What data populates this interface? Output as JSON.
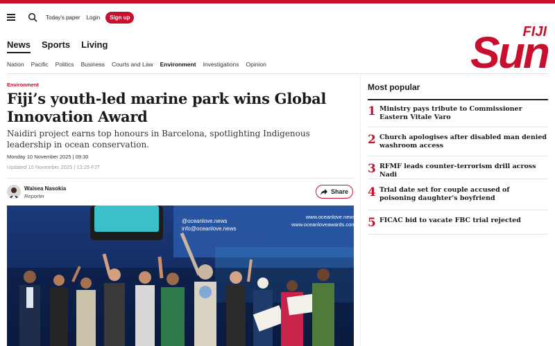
{
  "header": {
    "todays_paper": "Today's paper",
    "login": "Login",
    "signup": "Sign up",
    "logo_top": "FIJI",
    "logo_main": "Sun",
    "brand_color": "#c8102e"
  },
  "primary_nav": [
    "News",
    "Sports",
    "Living"
  ],
  "sub_nav": [
    "Nation",
    "Pacific",
    "Politics",
    "Business",
    "Courts and Law",
    "Environment",
    "Investigations",
    "Opinion"
  ],
  "article": {
    "kicker": "Environment",
    "headline": "Fiji’s youth-led marine park wins Global Innovation Award",
    "standfirst": "Naidiri project earns top honours in Barcelona, spotlighting Indigenous leadership in ocean conservation.",
    "date": "Monday 10 November 2025 | 09:30",
    "updated": "Updated 10 November 2025 | 13:25 FJT",
    "author_name": "Waisea Nasokia",
    "author_role": "Reporter",
    "share_label": "Share",
    "photo_text": {
      "handle_line1": "@oceanlove.news",
      "handle_line2": "info@oceanlove.news",
      "web_line1": "www.oceanlove.news",
      "web_line2": "www.oceanloveawards.com"
    }
  },
  "most_popular": {
    "title": "Most popular",
    "items": [
      {
        "rank": "1",
        "title": "Ministry pays tribute to Commissioner Eastern Vitale Varo"
      },
      {
        "rank": "2",
        "title": "Church apologises after disabled man denied washroom access"
      },
      {
        "rank": "3",
        "title": "RFMF leads counter-terrorism drill across Nadi"
      },
      {
        "rank": "4",
        "title": "Trial date set for couple accused of poisoning daughter's boyfriend"
      },
      {
        "rank": "5",
        "title": "FICAC bid to vacate FBC trial rejected"
      }
    ]
  },
  "icons": [
    "menu-icon",
    "search-icon",
    "share-arrow-icon"
  ]
}
